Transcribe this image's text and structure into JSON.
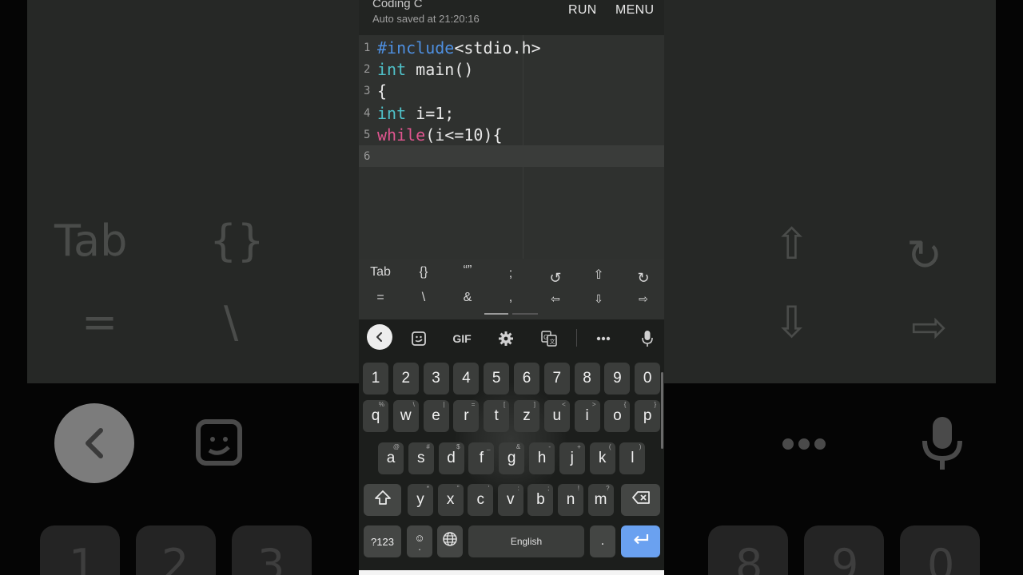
{
  "app": {
    "title": "Coding C",
    "subtitle": "Auto saved at 21:20:16",
    "run_label": "RUN",
    "menu_label": "MENU"
  },
  "editor": {
    "lines": [
      {
        "no": "1",
        "seg": [
          {
            "t": "#include",
            "c": "kw-blue"
          },
          {
            "t": "<stdio.h>",
            "c": ""
          }
        ]
      },
      {
        "no": "2",
        "seg": [
          {
            "t": "int",
            "c": "kw-teal"
          },
          {
            "t": " main()",
            "c": ""
          }
        ]
      },
      {
        "no": "3",
        "seg": [
          {
            "t": "{",
            "c": ""
          }
        ]
      },
      {
        "no": "4",
        "seg": [
          {
            "t": "int",
            "c": "kw-teal"
          },
          {
            "t": " i=1;",
            "c": ""
          }
        ]
      },
      {
        "no": "5",
        "seg": [
          {
            "t": "while",
            "c": "kw-pink"
          },
          {
            "t": "(i<=10){",
            "c": ""
          }
        ]
      },
      {
        "no": "6",
        "seg": []
      }
    ],
    "active_line": "6"
  },
  "symbols": {
    "row1": [
      "Tab",
      "{}",
      "“”",
      ";",
      "↺",
      "⇧",
      "↻"
    ],
    "row2": [
      "=",
      "\\",
      "&",
      ",",
      "⇦",
      "⇩",
      "⇨"
    ]
  },
  "keyboard": {
    "toolbar": {
      "gif_label": "GIF",
      "icons": [
        "chevron-left-icon",
        "sticker-icon",
        "gif-icon",
        "settings-icon",
        "translate-icon",
        "more-icon",
        "mic-icon"
      ]
    },
    "numbers": [
      "1",
      "2",
      "3",
      "4",
      "5",
      "6",
      "7",
      "8",
      "9",
      "0"
    ],
    "row1": [
      {
        "k": "q",
        "h": "%"
      },
      {
        "k": "w",
        "h": "\\"
      },
      {
        "k": "e",
        "h": "|"
      },
      {
        "k": "r",
        "h": "="
      },
      {
        "k": "t",
        "h": "["
      },
      {
        "k": "z",
        "h": "]"
      },
      {
        "k": "u",
        "h": "<"
      },
      {
        "k": "i",
        "h": ">"
      },
      {
        "k": "o",
        "h": "{"
      },
      {
        "k": "p",
        "h": "}"
      }
    ],
    "row2": [
      {
        "k": "a",
        "h": "@"
      },
      {
        "k": "s",
        "h": "#"
      },
      {
        "k": "d",
        "h": "$"
      },
      {
        "k": "f",
        "h": "_"
      },
      {
        "k": "g",
        "h": "&"
      },
      {
        "k": "h",
        "h": "-"
      },
      {
        "k": "j",
        "h": "+"
      },
      {
        "k": "k",
        "h": "("
      },
      {
        "k": "l",
        "h": ")"
      }
    ],
    "row3": [
      {
        "k": "y",
        "h": "*"
      },
      {
        "k": "x",
        "h": "\""
      },
      {
        "k": "c",
        "h": "'"
      },
      {
        "k": "v",
        "h": ":"
      },
      {
        "k": "b",
        "h": ";"
      },
      {
        "k": "n",
        "h": "!"
      },
      {
        "k": "m",
        "h": "?"
      }
    ],
    "sym_key": "?123",
    "emoji_key": "☺",
    "space_label": "English",
    "period_key": "."
  },
  "background": {
    "keys": [
      "Tab",
      "{}",
      "=",
      "\\",
      "⇧",
      "↻",
      "⇩",
      "⇨",
      "1",
      "2",
      "3",
      "8",
      "9",
      "0"
    ]
  }
}
